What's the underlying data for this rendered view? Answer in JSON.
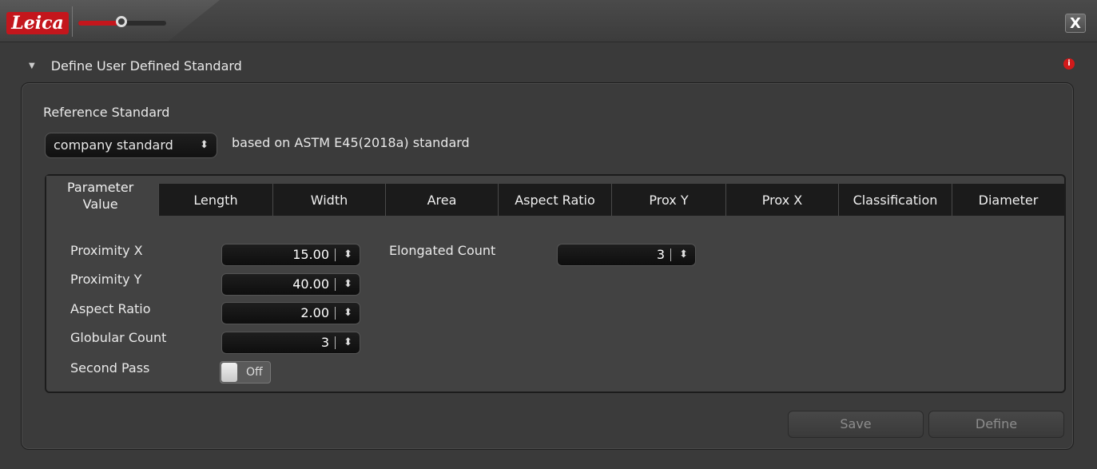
{
  "titlebar": {
    "logo_text": "Leica",
    "close_label": "X"
  },
  "section": {
    "title": "Define User Defined Standard",
    "info_label": "i"
  },
  "reference": {
    "label": "Reference Standard",
    "selected": "company standard",
    "based_on": "based on ASTM E45(2018a) standard"
  },
  "tabs": [
    {
      "label": "Parameter\nValue",
      "active": true
    },
    {
      "label": "Length"
    },
    {
      "label": "Width"
    },
    {
      "label": "Area"
    },
    {
      "label": "Aspect Ratio"
    },
    {
      "label": "Prox Y"
    },
    {
      "label": "Prox X"
    },
    {
      "label": "Classification"
    },
    {
      "label": "Diameter"
    }
  ],
  "fields": {
    "proximity_x": {
      "label": "Proximity X",
      "value": "15.00"
    },
    "proximity_y": {
      "label": "Proximity Y",
      "value": "40.00"
    },
    "aspect_ratio": {
      "label": "Aspect Ratio",
      "value": "2.00"
    },
    "globular_count": {
      "label": "Globular Count",
      "value": "3"
    },
    "second_pass": {
      "label": "Second Pass",
      "value": "Off"
    },
    "elongated_count": {
      "label": "Elongated Count",
      "value": "3"
    }
  },
  "buttons": {
    "save": "Save",
    "define": "Define"
  },
  "colors": {
    "accent": "#c4161c",
    "background": "#3a3a3a"
  }
}
